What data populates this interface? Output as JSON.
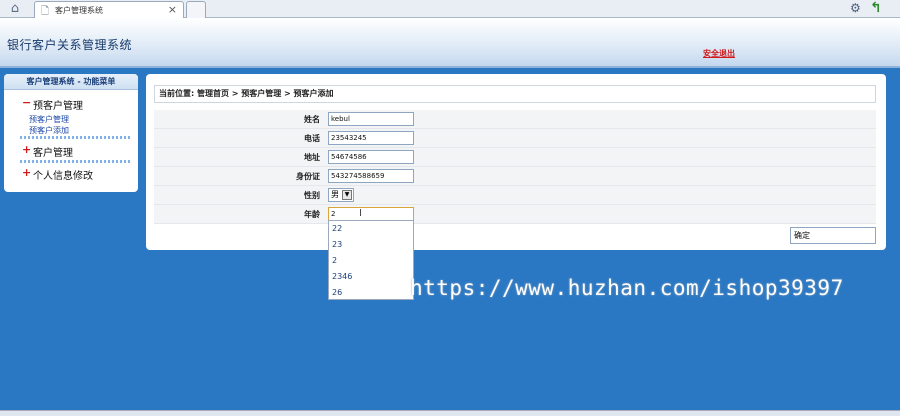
{
  "browser": {
    "tab_title": "客户管理系统",
    "tab_close": "×"
  },
  "header": {
    "system_title": "银行客户关系管理系统",
    "logout": "安全退出"
  },
  "sidebar": {
    "heading": "客户管理系统 - 功能菜单",
    "groups": [
      {
        "sign": "−",
        "title": "预客户管理",
        "items": [
          "预客户管理",
          "预客户添加"
        ]
      },
      {
        "sign": "+",
        "title": "客户管理"
      },
      {
        "sign": "+",
        "title": "个人信息修改"
      }
    ]
  },
  "breadcrumb": "当前位置: 管理首页 > 预客户管理 > 预客户添加",
  "form": {
    "fields": [
      {
        "label": "姓名",
        "value": "kebul"
      },
      {
        "label": "电话",
        "value": "23543245"
      },
      {
        "label": "地址",
        "value": "54674586"
      },
      {
        "label": "身份证",
        "value": "543274588659"
      },
      {
        "label": "性别",
        "value": "男"
      },
      {
        "label": "年龄",
        "value": "2"
      }
    ],
    "submit_label": "确定"
  },
  "autocomplete": {
    "options": [
      "22",
      "23",
      "2",
      "2346",
      "26"
    ]
  },
  "watermark": "https://www.huzhan.com/ishop39397"
}
